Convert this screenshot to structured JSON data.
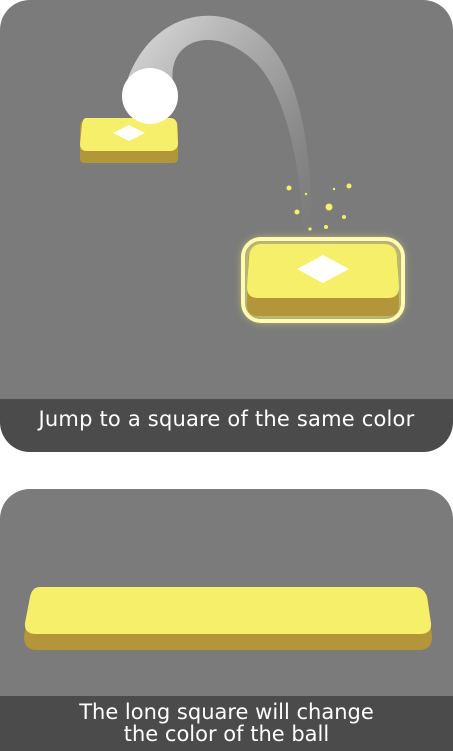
{
  "tutorial": {
    "step1": {
      "caption": "Jump to a square of the same color"
    },
    "step2": {
      "caption_line1": "The long square will change",
      "caption_line2": "the color of the ball"
    }
  },
  "colors": {
    "card_background": "#7b7b7b",
    "caption_background": "#4b4b4b",
    "tile_top": "#f6ef6a",
    "tile_side": "#b3963a",
    "ball": "#ffffff",
    "glow": "#fbf66e"
  }
}
